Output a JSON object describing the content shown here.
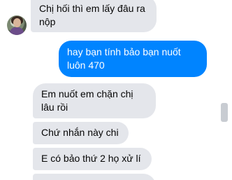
{
  "messages": [
    {
      "direction": "in",
      "text": "Chị hối thì em lấy đâu ra nộp"
    },
    {
      "direction": "out",
      "text": "hay bạn tính bảo bạn nuốt luôn 470"
    },
    {
      "direction": "in",
      "text": "Em nuốt em chặn chị lâu rồi"
    },
    {
      "direction": "in",
      "text": "Chứ nhắn này chi"
    },
    {
      "direction": "in",
      "text": "E có bảo thứ 2 họ xử lí"
    }
  ],
  "colors": {
    "incoming_bubble": "#e4e6eb",
    "outgoing_bubble": "#0084ff",
    "outgoing_text": "#ffffff",
    "incoming_text": "#050505"
  }
}
